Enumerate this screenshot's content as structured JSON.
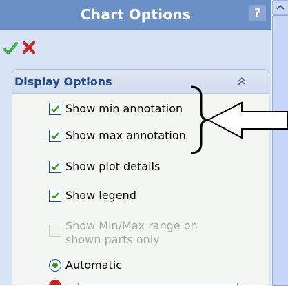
{
  "header": {
    "title": "Chart Options",
    "help_label": "?"
  },
  "actions": {
    "ok_icon": "green-checkmark-icon",
    "cancel_icon": "red-x-icon"
  },
  "display_options": {
    "title": "Display Options",
    "collapse_icon": "double-chevron-up-icon",
    "options": [
      {
        "label": "Show min annotation",
        "checked": true
      },
      {
        "label": "Show max annotation",
        "checked": true
      },
      {
        "label": "Show plot details",
        "checked": true
      },
      {
        "label": "Show legend",
        "checked": true
      },
      {
        "label": "Show Min/Max range on shown parts only",
        "label_lines": [
          "Show Min/Max range on",
          "shown parts only"
        ],
        "checked": false,
        "disabled": true
      }
    ],
    "range_mode": {
      "label": "Automatic",
      "selected": true
    }
  },
  "colors": {
    "title_bar": "#6a90c7",
    "pane_background": "#d8e4f6",
    "group_title": "#214c8a",
    "checkmark": "#2d9e2d",
    "cancel_x": "#cc2222"
  },
  "annotation_overlay": {
    "shape": "bracket-and-left-arrow",
    "stroke_color": "#000000"
  }
}
